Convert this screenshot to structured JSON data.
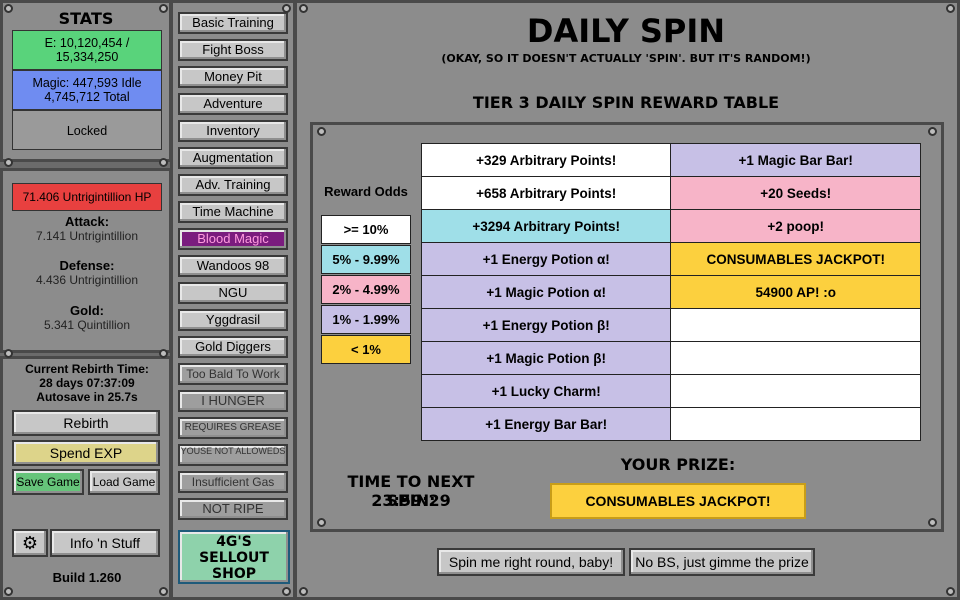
{
  "colors": {
    "energy": "#59d37b",
    "magic": "#6f8cf1",
    "hp": "#e8403f",
    "tier1": "#ffffff",
    "tier2": "#9fdfe8",
    "tier3": "#f7b4c8",
    "tier4": "#c7c0e6",
    "tier5": "#fcd03e",
    "blood_magic": "#7a1c7e",
    "shop": "#8ed2ab"
  },
  "stats": {
    "title": "STATS",
    "energy_line1": "E: 10,120,454 /",
    "energy_line2": "15,334,250",
    "magic_line1": "Magic: 447,593 Idle",
    "magic_line2": "4,745,712 Total",
    "locked": "Locked"
  },
  "combat": {
    "hp": "71.406 Untrigintillion HP",
    "attack_label": "Attack:",
    "attack_value": "7.141 Untrigintillion",
    "defense_label": "Defense:",
    "defense_value": "4.436 Untrigintillion",
    "gold_label": "Gold:",
    "gold_value": "5.341 Quintillion"
  },
  "rebirth": {
    "time_label": "Current Rebirth Time:",
    "time_value": "28 days 07:37:09",
    "autosave": "Autosave in 25.7s",
    "rebirth_btn": "Rebirth",
    "spend_exp_btn": "Spend EXP",
    "save_btn": "Save Game",
    "load_btn": "Load Game",
    "info_btn": "Info 'n Stuff",
    "build": "Build 1.260"
  },
  "nav": [
    "Basic Training",
    "Fight Boss",
    "Money Pit",
    "Adventure",
    "Inventory",
    "Augmentation",
    "Adv. Training",
    "Time Machine",
    "Blood Magic",
    "Wandoos 98",
    "NGU",
    "Yggdrasil",
    "Gold Diggers",
    "Too Bald To Work",
    "I HUNGER",
    "REQUIRES GREASE",
    "YOUSE NOT ALLOWEDS",
    "Insufficient Gas",
    "NOT RIPE"
  ],
  "shop": "4G'S SELLOUT SHOP",
  "main": {
    "title": "DAILY SPIN",
    "subtitle": "(OKAY, SO IT DOESN'T ACTUALLY 'SPIN'. BUT IT'S RANDOM!)",
    "table_title": "TIER 3 DAILY SPIN REWARD TABLE",
    "odds_title": "Reward Odds",
    "odds": [
      ">= 10%",
      "5% - 9.99%",
      "2% - 4.99%",
      "1% - 1.99%",
      "< 1%"
    ],
    "next_spin_label": "TIME TO NEXT SPIN:",
    "next_spin_time": "23:59:29",
    "prize_label": "YOUR PRIZE:",
    "prize_value": "CONSUMABLES JACKPOT!",
    "spin_btn": "Spin me right round, baby!",
    "gimme_btn": "No BS, just gimme the prize"
  },
  "rewards": {
    "left": [
      {
        "text": "+329 Arbitrary Points!",
        "tier": 1
      },
      {
        "text": "+658 Arbitrary Points!",
        "tier": 1
      },
      {
        "text": "+3294 Arbitrary Points!",
        "tier": 2
      },
      {
        "text": "+1 Energy Potion α!",
        "tier": 4
      },
      {
        "text": "+1 Magic Potion α!",
        "tier": 4
      },
      {
        "text": "+1 Energy Potion β!",
        "tier": 4
      },
      {
        "text": "+1 Magic Potion β!",
        "tier": 4
      },
      {
        "text": "+1 Lucky Charm!",
        "tier": 4
      },
      {
        "text": "+1 Energy Bar Bar!",
        "tier": 4
      }
    ],
    "right": [
      {
        "text": "+1 Magic Bar Bar!",
        "tier": 4
      },
      {
        "text": "+20 Seeds!",
        "tier": 3
      },
      {
        "text": "+2 poop!",
        "tier": 3
      },
      {
        "text": "CONSUMABLES JACKPOT!",
        "tier": 5
      },
      {
        "text": "54900 AP! :o",
        "tier": 5
      },
      {
        "text": "",
        "tier": 1
      },
      {
        "text": "",
        "tier": 1
      },
      {
        "text": "",
        "tier": 1
      },
      {
        "text": "",
        "tier": 1
      }
    ]
  }
}
